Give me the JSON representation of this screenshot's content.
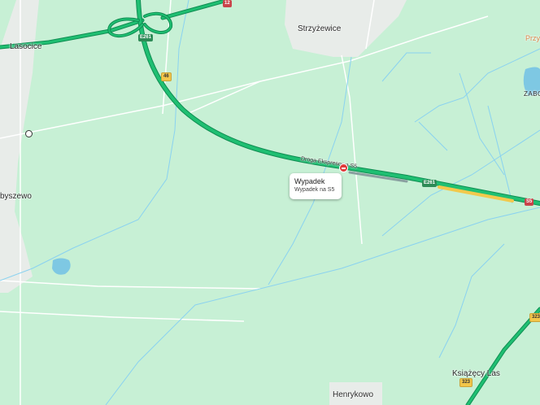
{
  "places": {
    "lasocice": "Lasocice",
    "strzyzewice": "Strzyżewice",
    "przy": "Przy",
    "zabo": "ZABO",
    "byszewo": "byszewo",
    "henrykowo": "Henrykowo",
    "ksiazecy_las": "Książęcy Las"
  },
  "roads": {
    "s5_label": "Droga Ekspresowa S5",
    "t12": "12",
    "e261_top": "E261",
    "r46": "46",
    "e261_right": "E261",
    "s5_shield": "S5",
    "r323_top": "323",
    "r323_bottom": "323"
  },
  "incident": {
    "title": "Wypadek",
    "subtitle": "Wypadek na S5",
    "icon": "accident-icon"
  },
  "colors": {
    "land": "#c7f0d5",
    "expressway": "#19b36a",
    "water": "#7ec8e3",
    "incident_red": "#e03a3a",
    "slow_traffic": "#f2c94c"
  }
}
